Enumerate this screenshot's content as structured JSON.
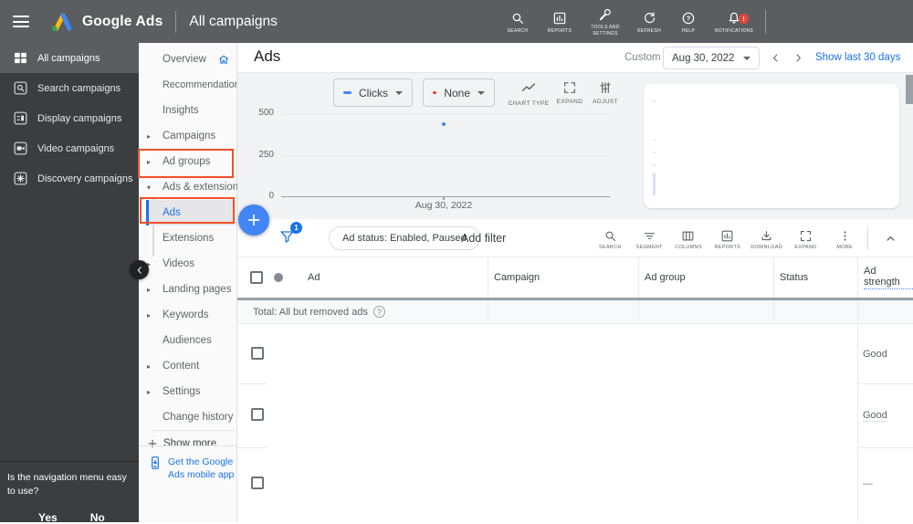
{
  "topbar": {
    "product": "Google Ads",
    "context": "All campaigns",
    "actions": [
      {
        "label": "SEARCH"
      },
      {
        "label": "REPORTS"
      },
      {
        "label": "TOOLS AND SETTINGS"
      },
      {
        "label": "REFRESH"
      },
      {
        "label": "HELP"
      },
      {
        "label": "NOTIFICATIONS",
        "badge": "!"
      }
    ]
  },
  "campaign_sidebar": {
    "items": [
      {
        "label": "All campaigns"
      },
      {
        "label": "Search campaigns"
      },
      {
        "label": "Display campaigns"
      },
      {
        "label": "Video campaigns"
      },
      {
        "label": "Discovery campaigns"
      }
    ],
    "survey": {
      "question": "Is the navigation menu easy to use?",
      "yes_label": "Yes",
      "no_label": "No"
    }
  },
  "nav": {
    "items": [
      {
        "label": "Overview",
        "arrow": ""
      },
      {
        "label": "Recommendations",
        "arrow": ""
      },
      {
        "label": "Insights",
        "arrow": ""
      },
      {
        "label": "Campaigns",
        "arrow": "▸"
      },
      {
        "label": "Ad groups",
        "arrow": "▸"
      },
      {
        "label": "Ads & extensions",
        "arrow": "▾"
      },
      {
        "label": "Ads",
        "arrow": ""
      },
      {
        "label": "Extensions",
        "arrow": ""
      },
      {
        "label": "Videos",
        "arrow": "▸"
      },
      {
        "label": "Landing pages",
        "arrow": "▸"
      },
      {
        "label": "Keywords",
        "arrow": "▸"
      },
      {
        "label": "Audiences",
        "arrow": ""
      },
      {
        "label": "Content",
        "arrow": "▸"
      },
      {
        "label": "Settings",
        "arrow": "▸"
      },
      {
        "label": "Change history",
        "arrow": ""
      }
    ],
    "show_more": "Show more",
    "mobile_app": "Get the Google Ads mobile app"
  },
  "page_header": {
    "title": "Ads",
    "date_mode": "Custom",
    "date_value": "Aug 30, 2022",
    "quick_range": "Show last 30 days"
  },
  "chart_controls": {
    "metric_primary": "Clicks",
    "metric_secondary": "None",
    "chart_type_label": "CHART TYPE",
    "expand_label": "EXPAND",
    "adjust_label": "ADJUST"
  },
  "chart_data": {
    "type": "line",
    "title": "",
    "x": [
      "Aug 30, 2022"
    ],
    "series": [
      {
        "name": "Clicks",
        "color": "#4285f4",
        "values": [
          430
        ]
      },
      {
        "name": "None",
        "color": "#ea4335",
        "values": []
      }
    ],
    "y_ticks": [
      "0",
      "250",
      "500"
    ],
    "ylim": [
      0,
      500
    ],
    "x_axis_label": "Aug 30, 2022",
    "grid": "horizontal",
    "legend_position": "none"
  },
  "filter_bar": {
    "filter_count": "1",
    "status_chip": "Ad status: Enabled, Paused",
    "add_filter_label": "Add filter",
    "tools": [
      {
        "label": "SEARCH"
      },
      {
        "label": "SEGMENT"
      },
      {
        "label": "COLUMNS"
      },
      {
        "label": "REPORTS"
      },
      {
        "label": "DOWNLOAD"
      },
      {
        "label": "EXPAND"
      },
      {
        "label": "MORE"
      }
    ]
  },
  "table": {
    "columns": [
      "Ad",
      "Campaign",
      "Ad group",
      "Status",
      "Ad strength"
    ],
    "total_label": "Total: All but removed ads",
    "rows": [
      {
        "ad_strength": "Good"
      },
      {
        "ad_strength": "Good"
      },
      {
        "ad_strength": "—"
      }
    ]
  },
  "colors": {
    "accent_blue": "#1a73e8",
    "fab_blue": "#4285f4",
    "highlight_red": "#f0502a",
    "topbar_gray": "#5b5e61",
    "sidebar_dark": "#3b3e41",
    "notification_red": "#e8453c",
    "series_primary": "#4285f4",
    "series_secondary": "#ea4335"
  }
}
